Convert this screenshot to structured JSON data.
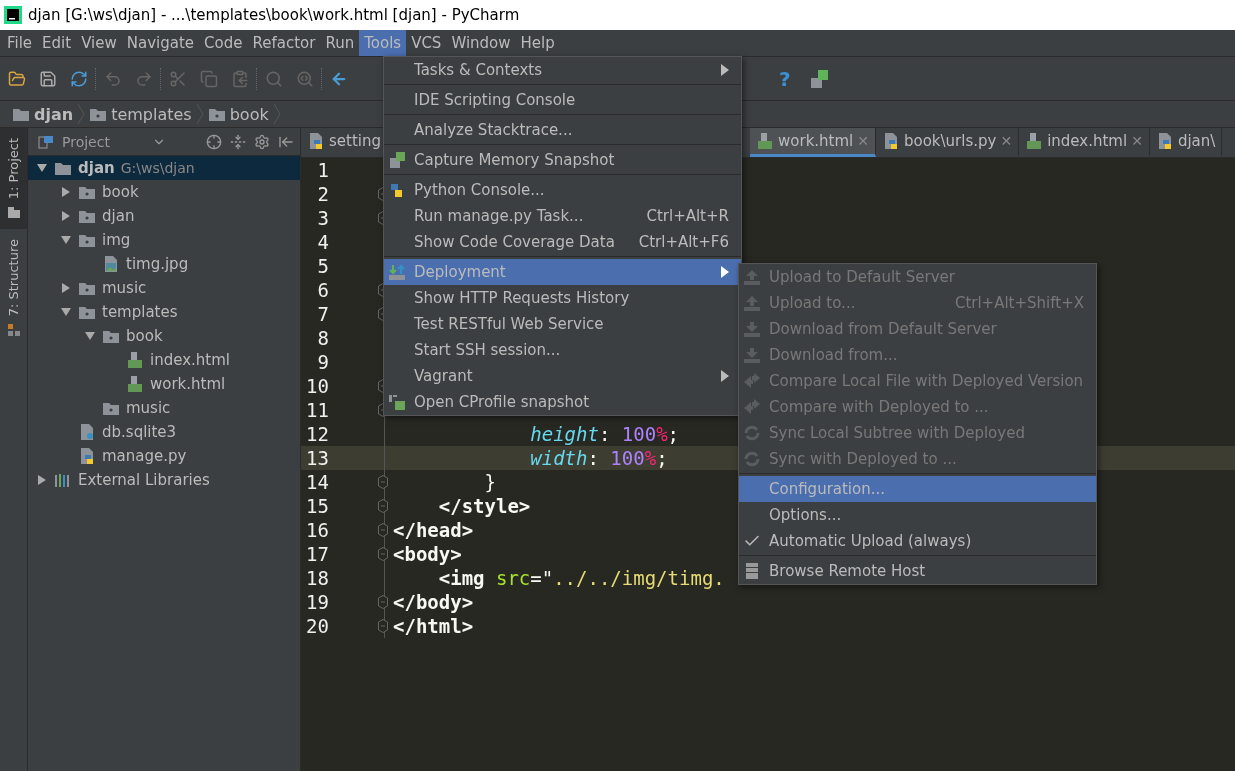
{
  "window": {
    "title": "djan [G:\\ws\\djan] - ...\\templates\\book\\work.html [djan] - PyCharm"
  },
  "menu_bar": [
    {
      "label": "File",
      "selected": false
    },
    {
      "label": "Edit",
      "selected": false
    },
    {
      "label": "View",
      "selected": false
    },
    {
      "label": "Navigate",
      "selected": false
    },
    {
      "label": "Code",
      "selected": false
    },
    {
      "label": "Refactor",
      "selected": false
    },
    {
      "label": "Run",
      "selected": false
    },
    {
      "label": "Tools",
      "selected": true
    },
    {
      "label": "VCS",
      "selected": false
    },
    {
      "label": "Window",
      "selected": false
    },
    {
      "label": "Help",
      "selected": false
    }
  ],
  "toolbar": {
    "help": "?"
  },
  "breadcrumbs": [
    "djan",
    "templates",
    "book"
  ],
  "tool_strip": [
    {
      "label": "1: Project",
      "selected": true
    },
    {
      "label": "7: Structure",
      "selected": false
    }
  ],
  "project_panel": {
    "title": "Project",
    "tree": [
      {
        "label": "djan",
        "path": "G:\\ws\\djan",
        "kind": "folder",
        "expanded": true,
        "selected": true,
        "children": [
          {
            "label": "book",
            "kind": "package",
            "expanded": false,
            "selected": false
          },
          {
            "label": "djan",
            "kind": "package",
            "expanded": false,
            "selected": false
          },
          {
            "label": "img",
            "kind": "package",
            "expanded": true,
            "selected": false,
            "children": [
              {
                "label": "timg.jpg",
                "kind": "image",
                "selected": false
              }
            ]
          },
          {
            "label": "music",
            "kind": "package",
            "expanded": false,
            "selected": false
          },
          {
            "label": "templates",
            "kind": "package",
            "expanded": true,
            "selected": false,
            "children": [
              {
                "label": "book",
                "kind": "package",
                "expanded": true,
                "selected": false,
                "children": [
                  {
                    "label": "index.html",
                    "kind": "html",
                    "selected": false
                  },
                  {
                    "label": "work.html",
                    "kind": "html",
                    "selected": false
                  }
                ]
              },
              {
                "label": "music",
                "kind": "package",
                "selected": false
              }
            ]
          },
          {
            "label": "db.sqlite3",
            "kind": "database",
            "selected": false
          },
          {
            "label": "manage.py",
            "kind": "python",
            "selected": false
          }
        ]
      },
      {
        "label": "External Libraries",
        "kind": "libraries",
        "expanded": false,
        "selected": false
      }
    ]
  },
  "editor_tabs": [
    {
      "label": "setting",
      "kind": "python",
      "selected": false
    },
    {
      "label": "work.html",
      "kind": "html",
      "selected": true,
      "close": "✕"
    },
    {
      "label": "book\\urls.py",
      "kind": "python",
      "selected": false,
      "close": "✕"
    },
    {
      "label": "index.html",
      "kind": "html",
      "selected": false,
      "close": "✕"
    },
    {
      "label": "djan\\",
      "kind": "python",
      "selected": false
    }
  ],
  "code": [
    {
      "number": "1",
      "fold": false,
      "current": false
    },
    {
      "number": "2",
      "fold": true,
      "current": false
    },
    {
      "number": "3",
      "fold": true,
      "current": false
    },
    {
      "number": "4",
      "fold": false,
      "current": false
    },
    {
      "number": "5",
      "fold": false,
      "current": false
    },
    {
      "number": "6",
      "fold": true,
      "current": false
    },
    {
      "number": "7",
      "fold": true,
      "current": false
    },
    {
      "number": "8",
      "fold": false,
      "current": false
    },
    {
      "number": "9",
      "fold": false,
      "current": false
    },
    {
      "number": "10",
      "fold": true,
      "current": false
    },
    {
      "number": "11",
      "fold": true,
      "current": false
    },
    {
      "number": "12",
      "fold": false,
      "current": false,
      "tokens": [
        {
          "kind": "prop",
          "text": "            height"
        },
        {
          "kind": "punct",
          "text": ": "
        },
        {
          "kind": "number",
          "text": "100"
        },
        {
          "kind": "unit",
          "text": "%"
        },
        {
          "kind": "punct",
          "text": ";"
        }
      ]
    },
    {
      "number": "13",
      "fold": false,
      "current": true,
      "tokens": [
        {
          "kind": "prop",
          "text": "            width"
        },
        {
          "kind": "punct",
          "text": ": "
        },
        {
          "kind": "number",
          "text": "100"
        },
        {
          "kind": "unit",
          "text": "%"
        },
        {
          "kind": "punct",
          "text": ";"
        }
      ]
    },
    {
      "number": "14",
      "fold": true,
      "current": false,
      "tokens": [
        {
          "kind": "punct",
          "text": "        }"
        }
      ]
    },
    {
      "number": "15",
      "fold": true,
      "current": false,
      "tokens": [
        {
          "kind": "tag",
          "text": "    </style>"
        }
      ]
    },
    {
      "number": "16",
      "fold": true,
      "current": false,
      "tokens": [
        {
          "kind": "tag",
          "text": "</head>"
        }
      ]
    },
    {
      "number": "17",
      "fold": true,
      "current": false,
      "tokens": [
        {
          "kind": "tag",
          "text": "<body>"
        }
      ]
    },
    {
      "number": "18",
      "fold": false,
      "current": false,
      "tokens": [
        {
          "kind": "tag",
          "text": "    <img"
        },
        {
          "kind": "attr",
          "text": " src"
        },
        {
          "kind": "punct",
          "text": "=\""
        },
        {
          "kind": "string",
          "text": "../../img/timg."
        }
      ]
    },
    {
      "number": "19",
      "fold": true,
      "current": false,
      "tokens": [
        {
          "kind": "tag",
          "text": "</body>"
        }
      ]
    },
    {
      "number": "20",
      "fold": true,
      "current": false,
      "tokens": [
        {
          "kind": "tag",
          "text": "</html>"
        }
      ]
    }
  ],
  "tools_menu": [
    [
      {
        "label": "Tasks & Contexts",
        "kind": "plain",
        "submenu": true,
        "selected": false
      }
    ],
    [
      {
        "label": "IDE Scripting Console",
        "kind": "plain",
        "submenu": false,
        "selected": false
      }
    ],
    [
      {
        "label": "Analyze Stacktrace...",
        "kind": "plain",
        "submenu": false,
        "selected": false
      }
    ],
    [
      {
        "label": "Capture Memory Snapshot",
        "kind": "memory",
        "submenu": false,
        "selected": false
      }
    ],
    [
      {
        "label": "Python Console...",
        "kind": "python",
        "submenu": false,
        "selected": false
      },
      {
        "label": "Run manage.py Task...",
        "shortcut": "Ctrl+Alt+R",
        "kind": "plain",
        "submenu": false,
        "selected": false
      },
      {
        "label": "Show Code Coverage Data",
        "shortcut": "Ctrl+Alt+F6",
        "kind": "plain",
        "submenu": false,
        "selected": false
      }
    ],
    [
      {
        "label": "Deployment",
        "kind": "deploy",
        "submenu": true,
        "selected": true
      },
      {
        "label": "Show HTTP Requests History",
        "kind": "plain",
        "submenu": false,
        "selected": false
      },
      {
        "label": "Test RESTful Web Service",
        "kind": "plain",
        "submenu": false,
        "selected": false
      },
      {
        "label": "Start SSH session...",
        "kind": "plain",
        "submenu": false,
        "selected": false
      },
      {
        "label": "Vagrant",
        "kind": "plain",
        "submenu": true,
        "selected": false
      },
      {
        "label": "Open CProfile snapshot",
        "kind": "profile",
        "submenu": false,
        "selected": false
      }
    ]
  ],
  "deployment_menu": [
    [
      {
        "label": "Upload to Default Server",
        "kind": "upload",
        "disabled": true,
        "selected": false,
        "checked": false
      },
      {
        "label": "Upload to...",
        "shortcut": "Ctrl+Alt+Shift+X",
        "kind": "upload",
        "disabled": true,
        "selected": false,
        "checked": false
      },
      {
        "label": "Download from Default Server",
        "kind": "download",
        "disabled": true,
        "selected": false,
        "checked": false
      },
      {
        "label": "Download from...",
        "kind": "download",
        "disabled": true,
        "selected": false,
        "checked": false
      },
      {
        "label": "Compare Local File with Deployed Version",
        "kind": "compare",
        "disabled": true,
        "selected": false,
        "checked": false
      },
      {
        "label": "Compare with Deployed to ...",
        "kind": "compare",
        "disabled": true,
        "selected": false,
        "checked": false
      },
      {
        "label": "Sync Local Subtree with Deployed",
        "kind": "sync",
        "disabled": true,
        "selected": false,
        "checked": false
      },
      {
        "label": "Sync with Deployed to ...",
        "kind": "sync",
        "disabled": true,
        "selected": false,
        "checked": false
      }
    ],
    [
      {
        "label": "Configuration...",
        "kind": "plain",
        "disabled": false,
        "selected": true,
        "checked": false
      },
      {
        "label": "Options...",
        "kind": "plain",
        "disabled": false,
        "selected": false,
        "checked": false
      },
      {
        "label": "Automatic Upload (always)",
        "disabled": false,
        "selected": false,
        "checked": true
      }
    ],
    [
      {
        "label": "Browse Remote Host",
        "kind": "server",
        "disabled": false,
        "selected": false,
        "checked": false
      }
    ]
  ]
}
